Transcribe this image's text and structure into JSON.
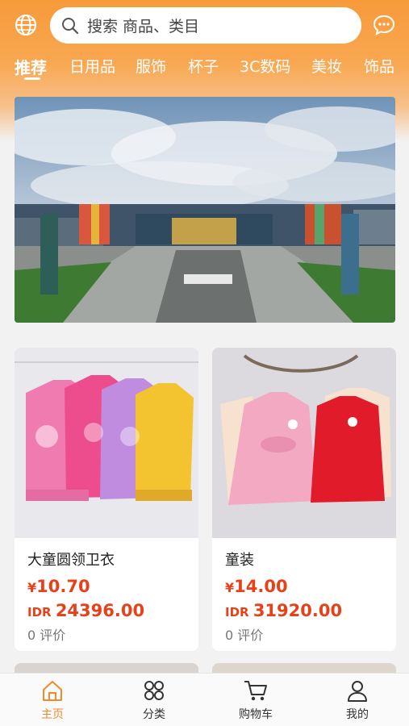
{
  "search": {
    "placeholder": "搜索 商品、类目"
  },
  "tabs": [
    {
      "label": "推荐",
      "active": true
    },
    {
      "label": "日用品"
    },
    {
      "label": "服饰"
    },
    {
      "label": "杯子"
    },
    {
      "label": "3C数码"
    },
    {
      "label": "美妆"
    },
    {
      "label": "饰品"
    }
  ],
  "products": [
    {
      "name": "大童圆领卫衣",
      "price_symbol": "¥",
      "price": "10.70",
      "idr_prefix": "IDR ",
      "idr": "24396.00",
      "reviews": "0 评价"
    },
    {
      "name": "童装",
      "price_symbol": "¥",
      "price": "14.00",
      "idr_prefix": "IDR ",
      "idr": "31920.00",
      "reviews": "0 评价"
    }
  ],
  "tabbar": [
    {
      "label": "主页",
      "icon": "home-icon",
      "active": true
    },
    {
      "label": "分类",
      "icon": "category-icon"
    },
    {
      "label": "购物车",
      "icon": "cart-icon"
    },
    {
      "label": "我的",
      "icon": "user-icon"
    }
  ],
  "colors": {
    "accent": "#f08a2a",
    "price": "#e8411a",
    "header": "#f79a3a"
  }
}
